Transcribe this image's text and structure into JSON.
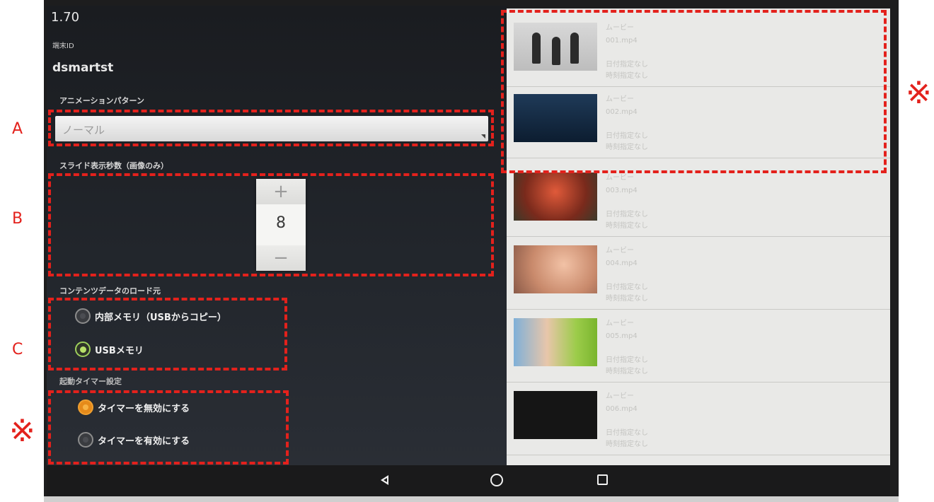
{
  "app": {
    "version": "1.70",
    "device_id_label": "端末ID",
    "device_id": "dsmartst"
  },
  "animation": {
    "label": "アニメーションパターン",
    "selected": "ノーマル",
    "marker": "A"
  },
  "slide": {
    "label": "スライド表示秒数（画像のみ）",
    "plus": "+",
    "value": "8",
    "minus": "−",
    "marker": "B"
  },
  "content_source": {
    "label": "コンテンツデータのロード元",
    "options": [
      {
        "label": "内部メモリ（USBからコピー）",
        "selected": false
      },
      {
        "label": "USBメモリ",
        "selected": true
      }
    ],
    "marker": "C"
  },
  "timer": {
    "label": "起動タイマー設定",
    "options": [
      {
        "label": "タイマーを無効にする",
        "selected": true
      },
      {
        "label": "タイマーを有効にする",
        "selected": false
      }
    ]
  },
  "annotation_mark": "※",
  "media_list": [
    {
      "type": "ムービー",
      "file": "001.mp4",
      "date": "日付指定なし",
      "time": "時刻指定なし"
    },
    {
      "type": "ムービー",
      "file": "002.mp4",
      "date": "日付指定なし",
      "time": "時刻指定なし"
    },
    {
      "type": "ムービー",
      "file": "003.mp4",
      "date": "日付指定なし",
      "time": "時刻指定なし"
    },
    {
      "type": "ムービー",
      "file": "004.mp4",
      "date": "日付指定なし",
      "time": "時刻指定なし"
    },
    {
      "type": "ムービー",
      "file": "005.mp4",
      "date": "日付指定なし",
      "time": "時刻指定なし"
    },
    {
      "type": "ムービー",
      "file": "006.mp4",
      "date": "日付指定なし",
      "time": "時刻指定なし"
    }
  ],
  "navbar": {
    "icons": [
      "back-icon",
      "home-icon",
      "recent-apps-icon"
    ]
  },
  "colors": {
    "annotation": "#e3211c",
    "radio_checked_green": "#b8e06a",
    "radio_checked_orange": "#e58a1a"
  }
}
